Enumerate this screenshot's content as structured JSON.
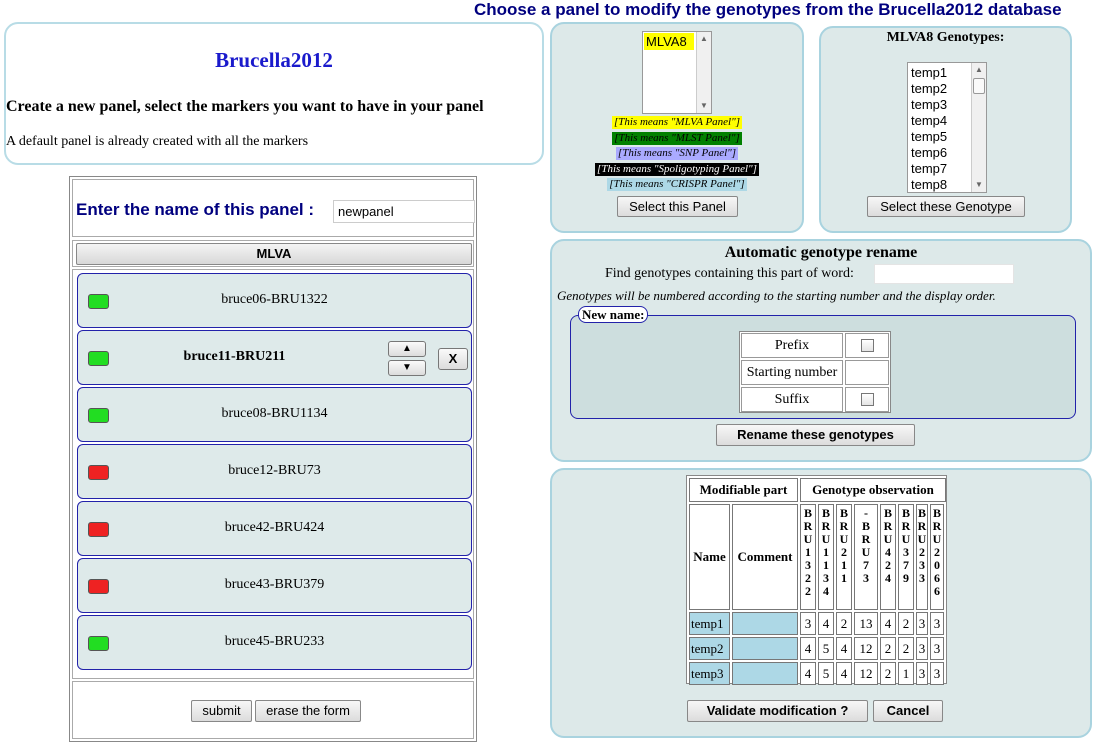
{
  "header": {
    "title": "Choose a panel to modify the genotypes from the Brucella2012 database"
  },
  "info": {
    "app_title": "Brucella2012",
    "heading": "Create a new panel, select the markers you want to have in your panel",
    "note": "A default panel is already created with all the markers"
  },
  "form": {
    "name_label": "Enter the name of this panel :",
    "name_value": "newpanel",
    "section_button": "MLVA",
    "markers": [
      {
        "name": "bruce06-BRU1322",
        "status": "on"
      },
      {
        "name": "bruce11-BRU211",
        "status": "on",
        "selected": true
      },
      {
        "name": "bruce08-BRU1134",
        "status": "on"
      },
      {
        "name": "bruce12-BRU73",
        "status": "off"
      },
      {
        "name": "bruce42-BRU424",
        "status": "off"
      },
      {
        "name": "bruce43-BRU379",
        "status": "off"
      },
      {
        "name": "bruce45-BRU233",
        "status": "on"
      }
    ],
    "remove_label": "X",
    "submit_label": "submit",
    "erase_label": "erase the form"
  },
  "panel_select": {
    "options": [
      "MLVA8"
    ],
    "legend": [
      {
        "text": "[This means \"MLVA Panel\"]",
        "bg": "#ffff00",
        "color": "#000000"
      },
      {
        "text": "[This means \"MLST Panel\"]",
        "bg": "#008000",
        "color": "#000000"
      },
      {
        "text": "[This means \"SNP Panel\"]",
        "bg": "#aaaaff",
        "color": "#000000"
      },
      {
        "text": "[This means \"Spoligotyping Panel\"]",
        "bg": "#000000",
        "color": "#ffffff"
      },
      {
        "text": "[This means \"CRISPR Panel\"]",
        "bg": "#add8e6",
        "color": "#000000"
      }
    ],
    "button": "Select this Panel"
  },
  "genotype_select": {
    "title": "MLVA8 Genotypes:",
    "options": [
      "temp1",
      "temp2",
      "temp3",
      "temp4",
      "temp5",
      "temp6",
      "temp7",
      "temp8"
    ],
    "button": "Select these Genotype"
  },
  "rename": {
    "title": "Automatic genotype rename",
    "find_label": "Find genotypes containing this part of word:",
    "note": "Genotypes will be numbered according to the starting number and the display order.",
    "legend": "New name:",
    "fields": [
      "Prefix",
      "Starting number",
      "Suffix"
    ],
    "button": "Rename these genotypes"
  },
  "observation": {
    "header_modifiable": "Modifiable part",
    "header_observation": "Genotype observation",
    "col_name": "Name",
    "col_comment": "Comment",
    "markers": [
      "BRU1322",
      "BRU1134",
      "BRU211",
      "-BRU73",
      "BRU424",
      "BRU379",
      "BRU233",
      "BRU2066"
    ],
    "rows": [
      {
        "name": "temp1",
        "values": [
          "3",
          "4",
          "2",
          "13",
          "4",
          "2",
          "3",
          "3"
        ]
      },
      {
        "name": "temp2",
        "values": [
          "4",
          "5",
          "4",
          "12",
          "2",
          "2",
          "3",
          "3"
        ]
      },
      {
        "name": "temp3",
        "values": [
          "4",
          "5",
          "4",
          "12",
          "2",
          "1",
          "3",
          "3"
        ]
      }
    ],
    "validate_label": "Validate modification ?",
    "cancel_label": "Cancel"
  },
  "colors": {
    "title_blue": "#00007f",
    "panel_bg": "#dde9e9",
    "marker_on": "#22dd22",
    "marker_off": "#ee2222"
  }
}
